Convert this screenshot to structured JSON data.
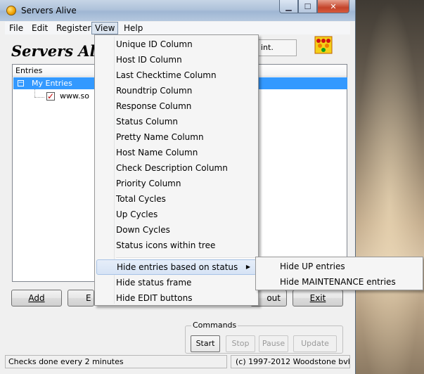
{
  "window": {
    "title": "Servers Alive"
  },
  "menubar": {
    "items": [
      "File",
      "Edit",
      "Register",
      "View",
      "Help"
    ]
  },
  "app": {
    "logo_text": "Servers Alive",
    "counter_text": "int."
  },
  "tree": {
    "header": "Entries",
    "root_label": "My Entries",
    "child_label": "www.so"
  },
  "buttons": {
    "add": "Add",
    "edit_partial": "E",
    "about_partial": "out",
    "exit": "Exit"
  },
  "commands": {
    "label": "Commands",
    "start": "Start",
    "stop": "Stop",
    "pause": "Pause",
    "update": "Update"
  },
  "statusbar": {
    "left": "Checks done every  2 minutes",
    "right": "(c) 1997-2012 Woodstone bvba"
  },
  "view_menu": {
    "items": [
      "Unique ID Column",
      "Host ID Column",
      "Last Checktime Column",
      "Roundtrip Column",
      "Response Column",
      "Status Column",
      "Pretty Name Column",
      "Host Name Column",
      "Check Description Column",
      "Priority Column",
      "Total Cycles",
      "Up Cycles",
      "Down Cycles",
      "Status icons within tree",
      "Hide entries based on status",
      "Hide status frame",
      "Hide EDIT buttons"
    ]
  },
  "status_submenu": {
    "items": [
      "Hide UP entries",
      "Hide MAINTENANCE entries"
    ]
  },
  "colors": {
    "selection": "#3399ff",
    "check_red": "#c00000"
  }
}
